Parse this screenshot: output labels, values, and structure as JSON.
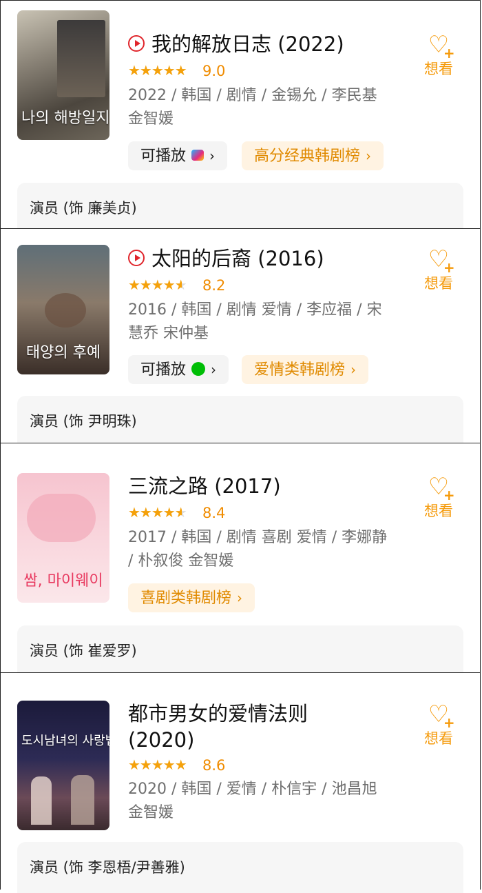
{
  "want_label": "想看",
  "items": [
    {
      "title": "我的解放日志 (2022)",
      "has_play_icon": true,
      "rating_stars": 4.5,
      "score": "9.0",
      "meta": "2022 / 韩国 / 剧情 / 金锡允 / 李民基 金智媛",
      "play_label": "可播放",
      "play_platform_icon": "youku-icon",
      "rank_label": "高分经典韩剧榜",
      "cast": "演员 (饰 廉美贞)",
      "poster_text": "나의 해방일지"
    },
    {
      "title": "太阳的后裔 (2016)",
      "has_play_icon": true,
      "rating_stars": 4,
      "score": "8.2",
      "meta": "2016 / 韩国 / 剧情 爱情 / 李应福 / 宋慧乔 宋仲基",
      "play_label": "可播放",
      "play_platform_icon": "iqiyi-icon",
      "rank_label": "爱情类韩剧榜",
      "cast": "演员 (饰 尹明珠)",
      "poster_text": "태양의 후예"
    },
    {
      "title": "三流之路 (2017)",
      "has_play_icon": false,
      "rating_stars": 4,
      "score": "8.4",
      "meta": "2017 / 韩国 / 剧情 喜剧 爱情 / 李娜静 / 朴叙俊 金智媛",
      "rank_label": "喜剧类韩剧榜",
      "cast": "演员 (饰 崔爱罗)",
      "poster_text": "쌈, 마이웨이"
    },
    {
      "title": "都市男女的爱情法则 (2020)",
      "has_play_icon": false,
      "rating_stars": 4.5,
      "score": "8.6",
      "meta": "2020 / 韩国 / 爱情 / 朴信宇 / 池昌旭 金智媛",
      "cast": "演员 (饰 李恩梧/尹善雅)",
      "poster_text": "도시남녀의 사랑법"
    }
  ]
}
